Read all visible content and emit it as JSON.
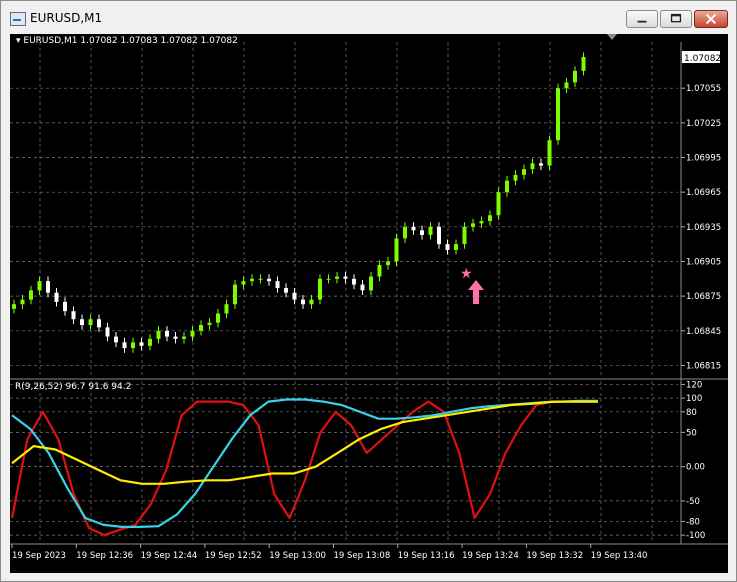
{
  "window": {
    "title": "EURUSD,M1"
  },
  "chart": {
    "symbol": "EURUSD,M1",
    "ohlc": "1.07082 1.07083 1.07082 1.07082",
    "current_price": "1.07082"
  },
  "price_axis": [
    "1.07055",
    "1.07025",
    "1.06995",
    "1.06965",
    "1.06935",
    "1.06905",
    "1.06875",
    "1.06845",
    "1.06815"
  ],
  "indicator": {
    "label": "R(9,26,52) 96.7 91.6 94.2",
    "axis": [
      "120",
      "100",
      "80",
      "50",
      "0.00",
      "-50",
      "-80",
      "-100"
    ]
  },
  "time_axis": [
    "19 Sep 2023",
    "19 Sep 12:36",
    "19 Sep 12:44",
    "19 Sep 12:52",
    "19 Sep 13:00",
    "19 Sep 13:08",
    "19 Sep 13:16",
    "19 Sep 13:24",
    "19 Sep 13:32",
    "19 Sep 13:40"
  ],
  "colors": {
    "background": "#000000",
    "grid": "#7a7a7a",
    "candle_up": "#7cfc00",
    "candle_down": "#ffffff",
    "line_red": "#e01010",
    "line_cyan": "#3ad0e8",
    "line_yellow": "#ffee00",
    "arrow": "#ff6fa8",
    "star": "#ff6fa8"
  },
  "icons": {
    "app": "chart-window-icon",
    "minimize": "minimize-icon",
    "maximize": "maximize-icon",
    "close": "close-icon",
    "dropdown": "triangle-down-icon",
    "buy_arrow": "up-arrow-icon",
    "signal": "star-icon"
  },
  "chart_data": {
    "type": "candlestick",
    "price": {
      "ylim": [
        1.06805,
        1.07095
      ],
      "close": [
        1.06868,
        1.06872,
        1.0688,
        1.06888,
        1.06878,
        1.0687,
        1.06862,
        1.06855,
        1.0685,
        1.06855,
        1.06848,
        1.0684,
        1.06835,
        1.0683,
        1.06835,
        1.06832,
        1.06838,
        1.06845,
        1.0684,
        1.06838,
        1.0684,
        1.06845,
        1.0685,
        1.06852,
        1.0686,
        1.06868,
        1.06885,
        1.06888,
        1.0689,
        1.0689,
        1.06888,
        1.06882,
        1.06878,
        1.06872,
        1.06868,
        1.06872,
        1.0689,
        1.0689,
        1.06892,
        1.0689,
        1.06885,
        1.0688,
        1.06892,
        1.06902,
        1.06905,
        1.06925,
        1.06935,
        1.06932,
        1.06928,
        1.06935,
        1.0692,
        1.06915,
        1.0692,
        1.06935,
        1.06938,
        1.0694,
        1.06945,
        1.06965,
        1.06975,
        1.0698,
        1.06985,
        1.0699,
        1.06988,
        1.0701,
        1.07055,
        1.0706,
        1.0707,
        1.07082
      ]
    },
    "indicator": {
      "ylim": [
        -110,
        125
      ],
      "series": [
        {
          "name": "red",
          "values": [
            -75,
            40,
            80,
            40,
            -40,
            -90,
            -100,
            -92,
            -85,
            -55,
            -5,
            75,
            95,
            95,
            95,
            90,
            60,
            -40,
            -75,
            -20,
            50,
            80,
            60,
            20,
            40,
            60,
            80,
            95,
            80,
            20,
            -75,
            -40,
            20,
            60,
            90,
            95,
            95,
            95,
            95
          ]
        },
        {
          "name": "cyan",
          "values": [
            75,
            55,
            20,
            -30,
            -75,
            -85,
            -88,
            -88,
            -87,
            -70,
            -40,
            0,
            40,
            75,
            95,
            98,
            98,
            95,
            90,
            80,
            70,
            70,
            72,
            75,
            80,
            85,
            88,
            90,
            92,
            94,
            95,
            96,
            96
          ]
        },
        {
          "name": "yellow",
          "values": [
            5,
            30,
            25,
            10,
            -5,
            -20,
            -25,
            -25,
            -22,
            -20,
            -20,
            -15,
            -10,
            -10,
            0,
            20,
            40,
            55,
            65,
            70,
            75,
            80,
            85,
            90,
            92,
            95,
            95,
            95
          ]
        }
      ]
    }
  }
}
